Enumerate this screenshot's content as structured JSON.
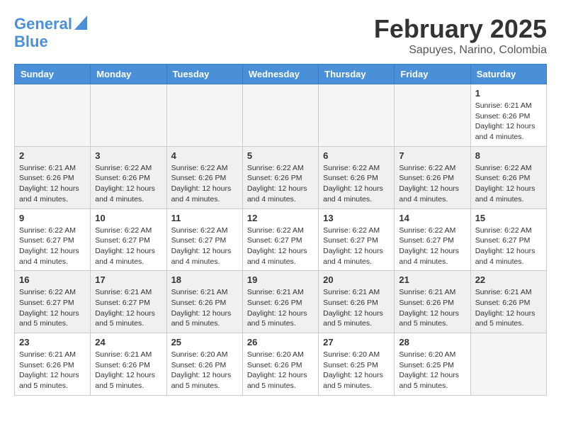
{
  "logo": {
    "line1": "General",
    "line2": "Blue"
  },
  "title": "February 2025",
  "location": "Sapuyes, Narino, Colombia",
  "days_of_week": [
    "Sunday",
    "Monday",
    "Tuesday",
    "Wednesday",
    "Thursday",
    "Friday",
    "Saturday"
  ],
  "weeks": [
    [
      {
        "day": "",
        "info": ""
      },
      {
        "day": "",
        "info": ""
      },
      {
        "day": "",
        "info": ""
      },
      {
        "day": "",
        "info": ""
      },
      {
        "day": "",
        "info": ""
      },
      {
        "day": "",
        "info": ""
      },
      {
        "day": "1",
        "info": "Sunrise: 6:21 AM\nSunset: 6:26 PM\nDaylight: 12 hours and 4 minutes."
      }
    ],
    [
      {
        "day": "2",
        "info": "Sunrise: 6:21 AM\nSunset: 6:26 PM\nDaylight: 12 hours and 4 minutes."
      },
      {
        "day": "3",
        "info": "Sunrise: 6:22 AM\nSunset: 6:26 PM\nDaylight: 12 hours and 4 minutes."
      },
      {
        "day": "4",
        "info": "Sunrise: 6:22 AM\nSunset: 6:26 PM\nDaylight: 12 hours and 4 minutes."
      },
      {
        "day": "5",
        "info": "Sunrise: 6:22 AM\nSunset: 6:26 PM\nDaylight: 12 hours and 4 minutes."
      },
      {
        "day": "6",
        "info": "Sunrise: 6:22 AM\nSunset: 6:26 PM\nDaylight: 12 hours and 4 minutes."
      },
      {
        "day": "7",
        "info": "Sunrise: 6:22 AM\nSunset: 6:26 PM\nDaylight: 12 hours and 4 minutes."
      },
      {
        "day": "8",
        "info": "Sunrise: 6:22 AM\nSunset: 6:26 PM\nDaylight: 12 hours and 4 minutes."
      }
    ],
    [
      {
        "day": "9",
        "info": "Sunrise: 6:22 AM\nSunset: 6:27 PM\nDaylight: 12 hours and 4 minutes."
      },
      {
        "day": "10",
        "info": "Sunrise: 6:22 AM\nSunset: 6:27 PM\nDaylight: 12 hours and 4 minutes."
      },
      {
        "day": "11",
        "info": "Sunrise: 6:22 AM\nSunset: 6:27 PM\nDaylight: 12 hours and 4 minutes."
      },
      {
        "day": "12",
        "info": "Sunrise: 6:22 AM\nSunset: 6:27 PM\nDaylight: 12 hours and 4 minutes."
      },
      {
        "day": "13",
        "info": "Sunrise: 6:22 AM\nSunset: 6:27 PM\nDaylight: 12 hours and 4 minutes."
      },
      {
        "day": "14",
        "info": "Sunrise: 6:22 AM\nSunset: 6:27 PM\nDaylight: 12 hours and 4 minutes."
      },
      {
        "day": "15",
        "info": "Sunrise: 6:22 AM\nSunset: 6:27 PM\nDaylight: 12 hours and 4 minutes."
      }
    ],
    [
      {
        "day": "16",
        "info": "Sunrise: 6:22 AM\nSunset: 6:27 PM\nDaylight: 12 hours and 5 minutes."
      },
      {
        "day": "17",
        "info": "Sunrise: 6:21 AM\nSunset: 6:27 PM\nDaylight: 12 hours and 5 minutes."
      },
      {
        "day": "18",
        "info": "Sunrise: 6:21 AM\nSunset: 6:26 PM\nDaylight: 12 hours and 5 minutes."
      },
      {
        "day": "19",
        "info": "Sunrise: 6:21 AM\nSunset: 6:26 PM\nDaylight: 12 hours and 5 minutes."
      },
      {
        "day": "20",
        "info": "Sunrise: 6:21 AM\nSunset: 6:26 PM\nDaylight: 12 hours and 5 minutes."
      },
      {
        "day": "21",
        "info": "Sunrise: 6:21 AM\nSunset: 6:26 PM\nDaylight: 12 hours and 5 minutes."
      },
      {
        "day": "22",
        "info": "Sunrise: 6:21 AM\nSunset: 6:26 PM\nDaylight: 12 hours and 5 minutes."
      }
    ],
    [
      {
        "day": "23",
        "info": "Sunrise: 6:21 AM\nSunset: 6:26 PM\nDaylight: 12 hours and 5 minutes."
      },
      {
        "day": "24",
        "info": "Sunrise: 6:21 AM\nSunset: 6:26 PM\nDaylight: 12 hours and 5 minutes."
      },
      {
        "day": "25",
        "info": "Sunrise: 6:20 AM\nSunset: 6:26 PM\nDaylight: 12 hours and 5 minutes."
      },
      {
        "day": "26",
        "info": "Sunrise: 6:20 AM\nSunset: 6:26 PM\nDaylight: 12 hours and 5 minutes."
      },
      {
        "day": "27",
        "info": "Sunrise: 6:20 AM\nSunset: 6:25 PM\nDaylight: 12 hours and 5 minutes."
      },
      {
        "day": "28",
        "info": "Sunrise: 6:20 AM\nSunset: 6:25 PM\nDaylight: 12 hours and 5 minutes."
      },
      {
        "day": "",
        "info": ""
      }
    ]
  ]
}
